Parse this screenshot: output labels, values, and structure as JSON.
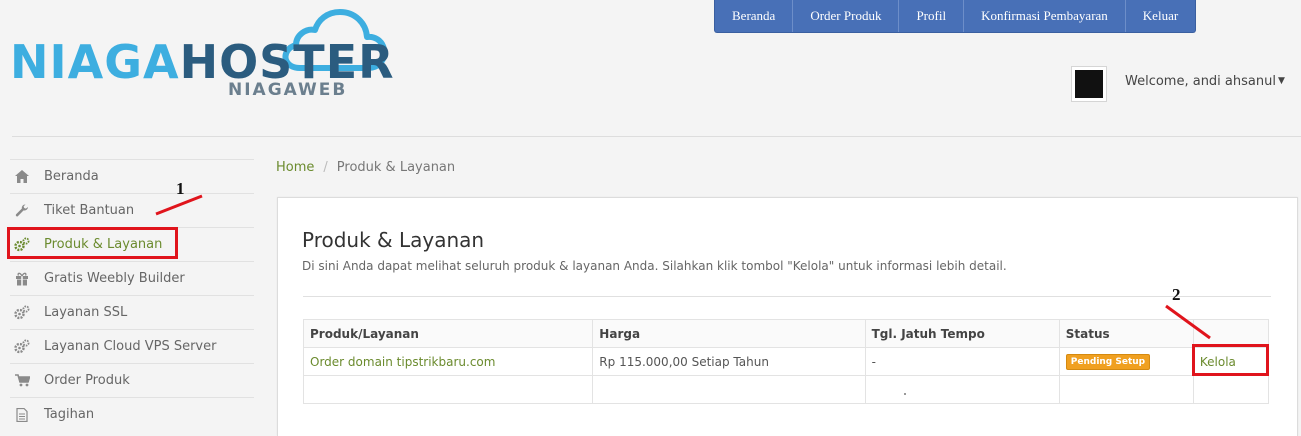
{
  "brand": {
    "logo_part1": "NIAGA",
    "logo_part2": "HOSTER",
    "logo_sub": "NIAGAWEB",
    "primary_color": "#3daee0",
    "secondary_color": "#2b5c7f"
  },
  "topnav": {
    "items": [
      {
        "label": "Beranda"
      },
      {
        "label": "Order Produk"
      },
      {
        "label": "Profil"
      },
      {
        "label": "Konfirmasi Pembayaran"
      },
      {
        "label": "Keluar"
      }
    ],
    "bg_color": "#4870b7"
  },
  "user": {
    "welcome_text": "Welcome, andi ahsanul",
    "caret_icon": "caret-down-icon"
  },
  "sidebar": {
    "items": [
      {
        "label": "Beranda",
        "icon": "home-icon"
      },
      {
        "label": "Tiket Bantuan",
        "icon": "wrench-icon"
      },
      {
        "label": "Produk & Layanan",
        "icon": "gears-icon",
        "active": true
      },
      {
        "label": "Gratis Weebly Builder",
        "icon": "gift-icon"
      },
      {
        "label": "Layanan SSL",
        "icon": "gears-icon"
      },
      {
        "label": "Layanan Cloud VPS Server",
        "icon": "gears-icon"
      },
      {
        "label": "Order Produk",
        "icon": "cart-icon"
      },
      {
        "label": "Tagihan",
        "icon": "document-icon"
      }
    ],
    "active_color": "#6b8b2e"
  },
  "annotations": {
    "label1": "1",
    "label2": "2",
    "color": "#e0141c"
  },
  "breadcrumb": {
    "home": "Home",
    "separator": "/",
    "current": "Produk & Layanan"
  },
  "panel": {
    "title": "Produk & Layanan",
    "description": "Di sini Anda dapat melihat seluruh produk & layanan Anda. Silahkan klik tombol \"Kelola\" untuk informasi lebih detail."
  },
  "table": {
    "headers": [
      "Produk/Layanan",
      "Harga",
      "Tgl. Jatuh Tempo",
      "Status"
    ],
    "rows": [
      {
        "product": "Order domain tipstrikbaru.com",
        "price": "Rp 115.000,00 Setiap Tahun",
        "due": "-",
        "status": "Pending Setup",
        "action": "Kelola"
      }
    ],
    "status_color": "#f0a020"
  }
}
